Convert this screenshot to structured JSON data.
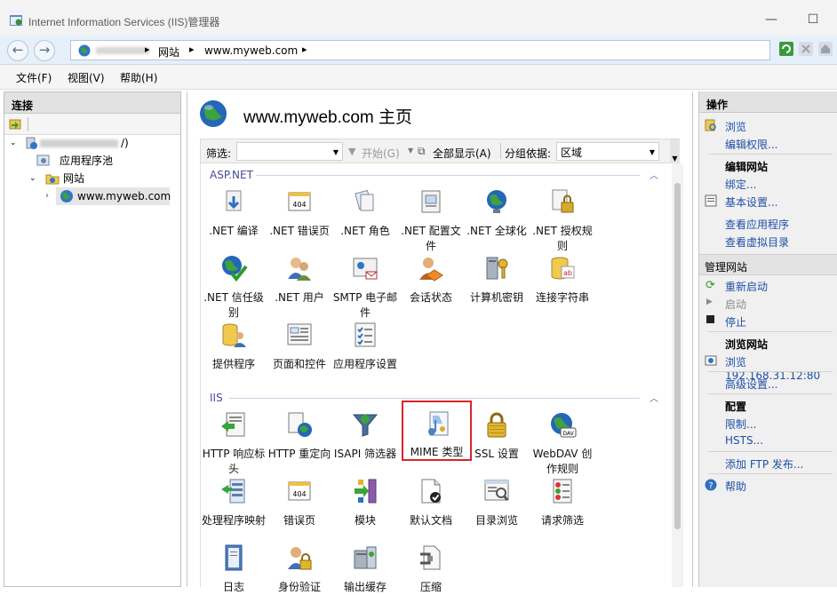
{
  "window": {
    "title": "Internet Information Services (IIS)管理器"
  },
  "address": {
    "segments": [
      "网站",
      "www.myweb.com"
    ]
  },
  "menu": [
    "文件(F)",
    "视图(V)",
    "帮助(H)"
  ],
  "connections": {
    "title": "连接",
    "server_suffix": "/)",
    "items": [
      "应用程序池",
      "网站",
      "www.myweb.com"
    ]
  },
  "main": {
    "title": "www.myweb.com 主页",
    "filter_label": "筛选:",
    "start_label": "开始(G)",
    "show_all_label": "全部显示(A)",
    "group_by_label": "分组依据:",
    "group_by_value": "区域"
  },
  "groups": [
    {
      "name": "ASP.NET",
      "features": [
        {
          "label": ".NET 编译",
          "icon": "dotnet-compilation-icon"
        },
        {
          "label": ".NET 错误页",
          "icon": "error-page-404-icon"
        },
        {
          "label": ".NET 角色",
          "icon": "dotnet-roles-icon"
        },
        {
          "label": ".NET 配置文件",
          "icon": "dotnet-profile-icon"
        },
        {
          "label": ".NET 全球化",
          "icon": "globalization-globe-icon"
        },
        {
          "label": ".NET 授权规则",
          "icon": "authorization-lock-icon"
        },
        {
          "label": ".NET 信任级别",
          "icon": "trust-level-check-icon"
        },
        {
          "label": ".NET 用户",
          "icon": "users-icon"
        },
        {
          "label": "SMTP 电子邮件",
          "icon": "smtp-email-icon"
        },
        {
          "label": "会话状态",
          "icon": "session-state-icon"
        },
        {
          "label": "计算机密钥",
          "icon": "machine-key-icon"
        },
        {
          "label": "连接字符串",
          "icon": "connection-string-icon"
        },
        {
          "label": "提供程序",
          "icon": "providers-icon"
        },
        {
          "label": "页面和控件",
          "icon": "pages-controls-icon"
        },
        {
          "label": "应用程序设置",
          "icon": "app-settings-icon"
        }
      ]
    },
    {
      "name": "IIS",
      "features": [
        {
          "label": "HTTP 响应标头",
          "icon": "http-headers-icon"
        },
        {
          "label": "HTTP 重定向",
          "icon": "http-redirect-icon"
        },
        {
          "label": "ISAPI 筛选器",
          "icon": "isapi-filter-icon"
        },
        {
          "label": "MIME 类型",
          "icon": "mime-types-icon"
        },
        {
          "label": "SSL 设置",
          "icon": "ssl-lock-icon"
        },
        {
          "label": "WebDAV 创作规则",
          "icon": "webdav-globe-icon"
        },
        {
          "label": "处理程序映射",
          "icon": "handler-mappings-icon"
        },
        {
          "label": "错误页",
          "icon": "error-page-icon"
        },
        {
          "label": "模块",
          "icon": "modules-icon"
        },
        {
          "label": "默认文档",
          "icon": "default-document-icon"
        },
        {
          "label": "目录浏览",
          "icon": "directory-browsing-icon"
        },
        {
          "label": "请求筛选",
          "icon": "request-filtering-icon"
        },
        {
          "label": "日志",
          "icon": "logging-icon"
        },
        {
          "label": "身份验证",
          "icon": "authentication-icon"
        },
        {
          "label": "输出缓存",
          "icon": "output-caching-icon"
        },
        {
          "label": "压缩",
          "icon": "compression-icon"
        }
      ]
    }
  ],
  "actions": {
    "title": "操作",
    "browse": "浏览",
    "edit_permissions": "编辑权限...",
    "edit_site_head": "编辑网站",
    "bindings": "绑定...",
    "basic_settings": "基本设置...",
    "view_apps": "查看应用程序",
    "view_vdirs": "查看虚拟目录",
    "manage_site_head": "管理网站",
    "restart": "重新启动",
    "start": "启动",
    "stop": "停止",
    "browse_site_head": "浏览网站",
    "browse_address": "浏览 192.168.31.12:80",
    "advanced_settings": "高级设置...",
    "config_head": "配置",
    "limits": "限制...",
    "hsts": "HSTS...",
    "add_ftp": "添加 FTP 发布...",
    "help": "帮助"
  },
  "colors": {
    "selection": "#d9252b",
    "link": "#1f4fa8",
    "group_header": "#4a4a9e"
  }
}
